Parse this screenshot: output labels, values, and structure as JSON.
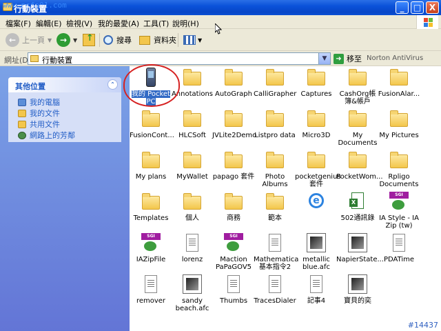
{
  "window": {
    "title": "行動裝置",
    "watermark": "www.pcfo01.com",
    "controls": [
      "_",
      "□",
      "X"
    ]
  },
  "menu": [
    "檔案(F)",
    "編輯(E)",
    "檢視(V)",
    "我的最愛(A)",
    "工具(T)",
    "說明(H)"
  ],
  "toolbar": {
    "back_label": "上一頁",
    "search_label": "搜尋",
    "folders_label": "資料夾"
  },
  "address": {
    "label": "網址(D)",
    "value": "行動裝置",
    "go_label": "移至",
    "norton": "Norton AntiVirus"
  },
  "other_places": {
    "title": "其他位置",
    "links": [
      "我的電腦",
      "我的文件",
      "共用文件",
      "網路上的芳鄰"
    ]
  },
  "items": [
    {
      "label": "我的 Pocket PC",
      "icon": "pda-icon"
    },
    {
      "label": "Annotations",
      "icon": "folder-icon"
    },
    {
      "label": "AutoGraph",
      "icon": "folder-icon"
    },
    {
      "label": "CalliGrapher",
      "icon": "folder-icon"
    },
    {
      "label": "Captures",
      "icon": "folder-icon"
    },
    {
      "label": "CashOrg帳簿&帳戶",
      "icon": "folder-icon"
    },
    {
      "label": "FusionAlar...",
      "icon": "folder-icon"
    },
    {
      "label": "FusionCont...",
      "icon": "folder-icon"
    },
    {
      "label": "HLCSoft",
      "icon": "folder-icon"
    },
    {
      "label": "JVLite2Demo",
      "icon": "folder-icon"
    },
    {
      "label": "Listpro data",
      "icon": "folder-icon"
    },
    {
      "label": "Micro3D",
      "icon": "folder-icon"
    },
    {
      "label": "My Documents",
      "icon": "folder-icon"
    },
    {
      "label": "My Pictures",
      "icon": "folder-icon"
    },
    {
      "label": "My plans",
      "icon": "folder-icon"
    },
    {
      "label": "MyWallet",
      "icon": "folder-icon"
    },
    {
      "label": "papago 套件",
      "icon": "folder-icon"
    },
    {
      "label": "Photo Albums",
      "icon": "folder-icon"
    },
    {
      "label": "pocketgenius 套件",
      "icon": "folder-icon"
    },
    {
      "label": "PocketWom...",
      "icon": "folder-icon"
    },
    {
      "label": "Rpligo Documents",
      "icon": "folder-icon"
    },
    {
      "label": "Templates",
      "icon": "folder-icon"
    },
    {
      "label": "個人",
      "icon": "folder-icon"
    },
    {
      "label": "商務",
      "icon": "folder-icon"
    },
    {
      "label": "範本",
      "icon": "folder-icon"
    },
    {
      "label": "",
      "icon": "ie-icon"
    },
    {
      "label": "502通訊錄",
      "icon": "excel-icon"
    },
    {
      "label": "IA Style - IA Zip (tw)",
      "icon": "sgi-icon"
    },
    {
      "label": "IAZipFile",
      "icon": "sgi-icon"
    },
    {
      "label": "lorenz",
      "icon": "document-icon"
    },
    {
      "label": "Maction PaPaGOV5",
      "icon": "sgi-icon"
    },
    {
      "label": "Mathematica基本指令2",
      "icon": "document-icon"
    },
    {
      "label": "metallic blue.afc",
      "icon": "app-icon"
    },
    {
      "label": "NapierState....",
      "icon": "app-icon"
    },
    {
      "label": "PDATime",
      "icon": "document-icon"
    },
    {
      "label": "remover",
      "icon": "document-icon"
    },
    {
      "label": "sandy beach.afc",
      "icon": "app-icon"
    },
    {
      "label": "Thumbs",
      "icon": "document-icon"
    },
    {
      "label": "TracesDialer",
      "icon": "document-icon"
    },
    {
      "label": "記事4",
      "icon": "document-icon"
    },
    {
      "label": "寶貝的奕",
      "icon": "app-icon"
    }
  ],
  "tag": "#14437"
}
